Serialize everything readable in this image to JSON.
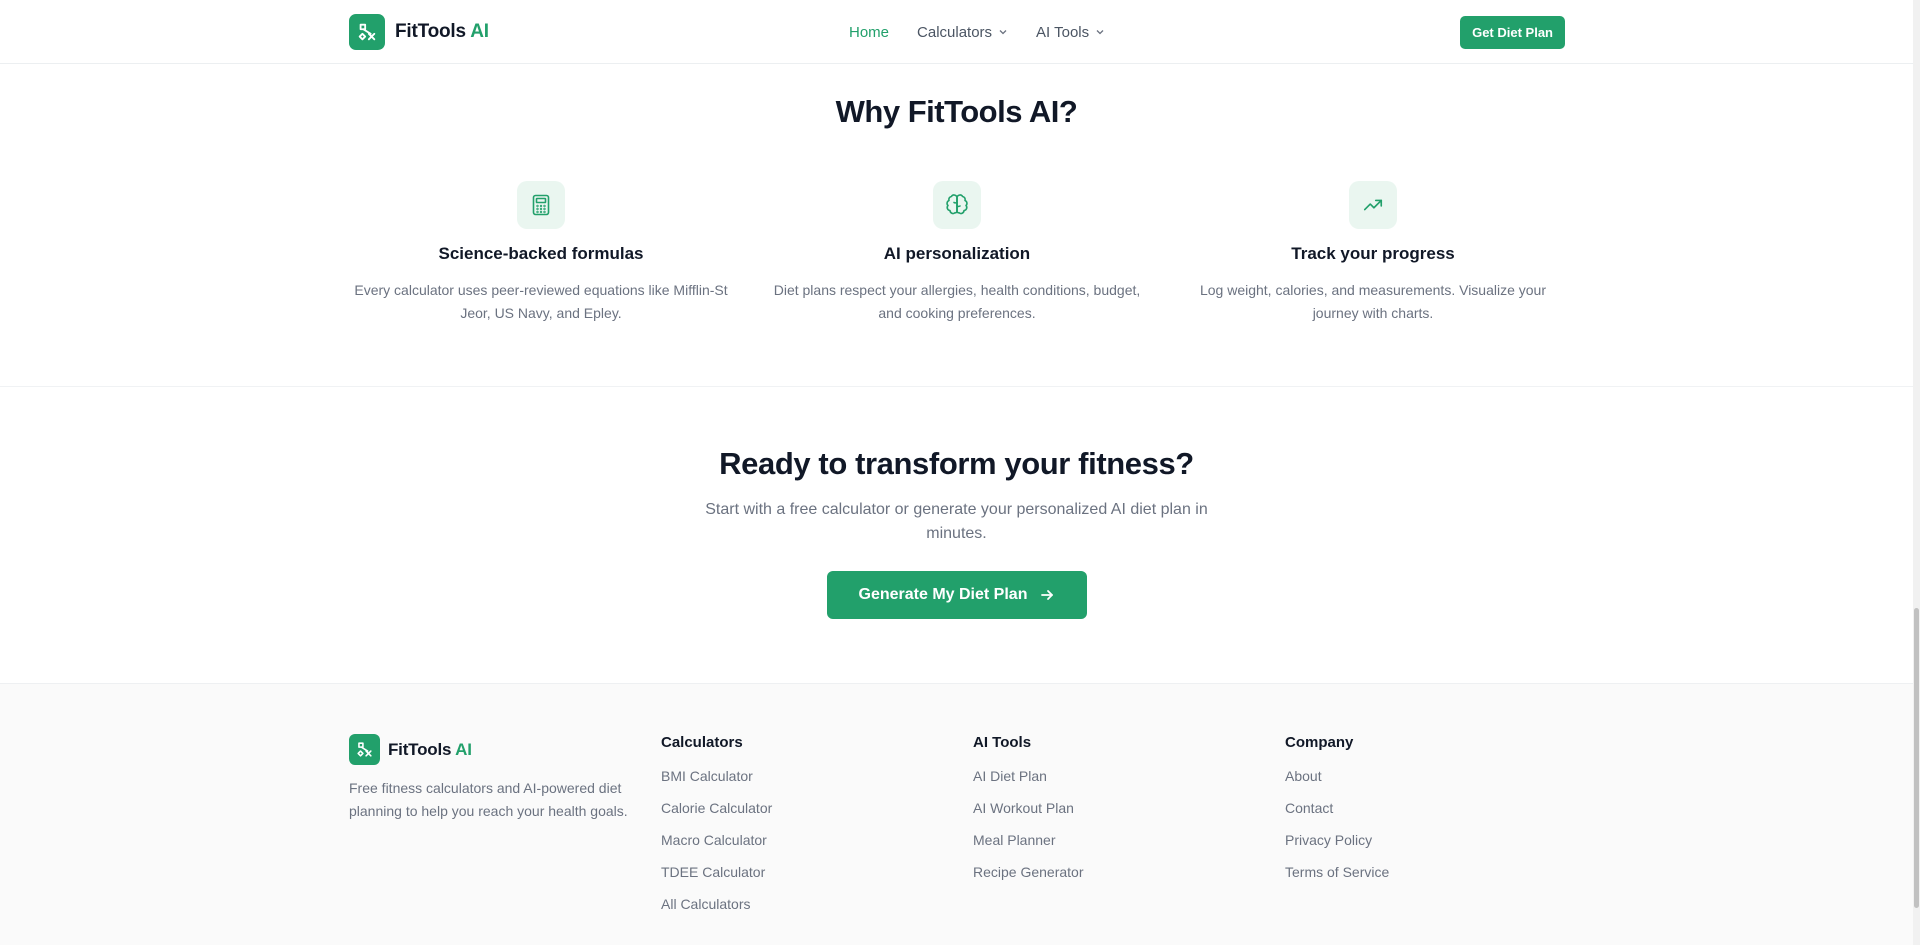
{
  "header": {
    "brand": "FitTools",
    "brand_accent": "AI",
    "nav": [
      {
        "label": "Home",
        "active": true
      },
      {
        "label": "Calculators",
        "has_dropdown": true
      },
      {
        "label": "AI Tools",
        "has_dropdown": true
      }
    ],
    "cta_label": "Get Diet Plan"
  },
  "why": {
    "title": "Why FitTools AI?",
    "features": [
      {
        "icon": "calculator-icon",
        "title": "Science-backed formulas",
        "text": "Every calculator uses peer-reviewed equations like Mifflin-St Jeor, US Navy, and Epley."
      },
      {
        "icon": "brain-icon",
        "title": "AI personalization",
        "text": "Diet plans respect your allergies, health conditions, budget, and cooking preferences."
      },
      {
        "icon": "trending-up-icon",
        "title": "Track your progress",
        "text": "Log weight, calories, and measurements. Visualize your journey with charts."
      }
    ]
  },
  "cta": {
    "title": "Ready to transform your fitness?",
    "subtitle": "Start with a free calculator or generate your personalized AI diet plan in minutes.",
    "button_label": "Generate My Diet Plan"
  },
  "footer": {
    "brand": "FitTools",
    "brand_accent": "AI",
    "description": "Free fitness calculators and AI-powered diet planning to help you reach your health goals.",
    "columns": [
      {
        "title": "Calculators",
        "links": [
          "BMI Calculator",
          "Calorie Calculator",
          "Macro Calculator",
          "TDEE Calculator",
          "All Calculators"
        ]
      },
      {
        "title": "AI Tools",
        "links": [
          "AI Diet Plan",
          "AI Workout Plan",
          "Meal Planner",
          "Recipe Generator"
        ]
      },
      {
        "title": "Company",
        "links": [
          "About",
          "Contact",
          "Privacy Policy",
          "Terms of Service"
        ]
      }
    ]
  },
  "colors": {
    "brand_green": "#22a06b",
    "icon_bg": "#eaf6f0",
    "text_dark": "#111827",
    "text_muted": "#6b7280"
  }
}
